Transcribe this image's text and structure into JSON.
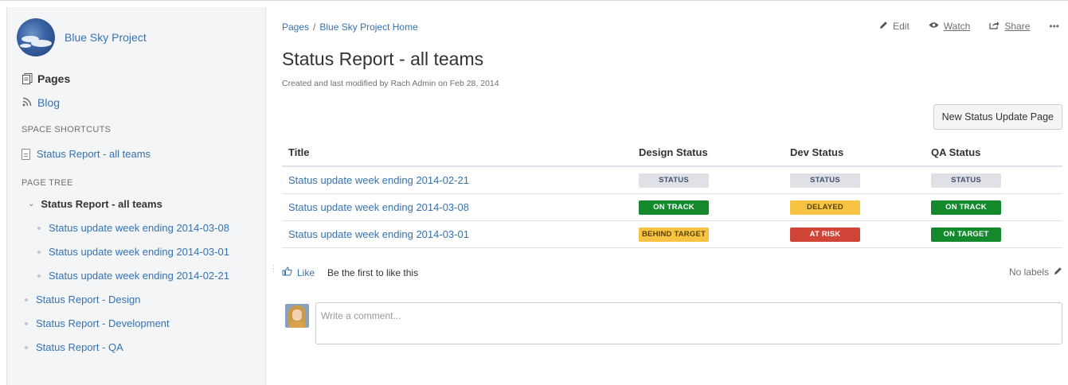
{
  "space": {
    "name": "Blue Sky Project"
  },
  "sidebar": {
    "pages_label": "Pages",
    "blog_label": "Blog",
    "shortcuts_heading": "SPACE SHORTCUTS",
    "shortcut": "Status Report - all teams",
    "tree_heading": "PAGE TREE",
    "tree_root": "Status Report - all teams",
    "tree_children": [
      "Status update week ending 2014-03-08",
      "Status update week ending 2014-03-01",
      "Status update week ending 2014-02-21"
    ],
    "tree_siblings": [
      "Status Report - Design",
      "Status Report - Development",
      "Status Report - QA"
    ]
  },
  "breadcrumb": {
    "root": "Pages",
    "sep": "/",
    "parent": "Blue Sky Project Home"
  },
  "page": {
    "title": "Status Report - all teams",
    "byline": "Created and last modified by Rach Admin on Feb 28, 2014"
  },
  "actions": {
    "edit": "Edit",
    "watch": "Watch",
    "share": "Share",
    "more": "•••"
  },
  "new_status_button": "New Status Update Page",
  "table": {
    "headers": [
      "Title",
      "Design Status",
      "Dev Status",
      "QA Status"
    ],
    "rows": [
      {
        "title": "Status update week ending 2014-02-21",
        "design": "STATUS",
        "dev": "STATUS",
        "qa": "STATUS"
      },
      {
        "title": "Status update week ending 2014-03-08",
        "design": "ON TRACK",
        "dev": "DELAYED",
        "qa": "ON TRACK"
      },
      {
        "title": "Status update week ending 2014-03-01",
        "design": "BEHIND TARGET",
        "dev": "AT RISK",
        "qa": "ON TARGET"
      }
    ]
  },
  "colors": {
    "link": "#3572b0",
    "green": "#14892c",
    "yellow": "#f6c342",
    "red": "#d04437",
    "grey": "#dfe1e6"
  },
  "like": {
    "label": "Like",
    "text": "Be the first to like this"
  },
  "labels_text": "No labels",
  "comment": {
    "placeholder": "Write a comment..."
  }
}
